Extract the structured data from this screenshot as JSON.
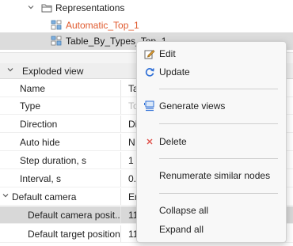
{
  "tree": {
    "representations_label": "Representations",
    "auto_label": "Automatic_Top_1",
    "table_label": "Table_By_Types_Top_1"
  },
  "properties": {
    "section_title": "Exploded view",
    "rows": [
      {
        "name": "Name",
        "value": "Ta"
      },
      {
        "name": "Type",
        "value": "To"
      },
      {
        "name": "Direction",
        "value": "Di"
      },
      {
        "name": "Auto hide",
        "value": "N"
      },
      {
        "name": "Step duration, s",
        "value": "1"
      },
      {
        "name": "Interval, s",
        "value": "0."
      },
      {
        "name": "Default camera",
        "value": "Er"
      },
      {
        "name": "Default camera posit..",
        "value": "11"
      },
      {
        "name": "Default target position",
        "value": "11"
      }
    ]
  },
  "context_menu": {
    "items": {
      "edit": "Edit",
      "update": "Update",
      "generate_views": "Generate views",
      "delete": "Delete",
      "renumerate": "Renumerate similar nodes",
      "collapse_all": "Collapse all",
      "expand_all": "Expand all"
    }
  },
  "colors": {
    "accent_orange": "#e05a2e",
    "update_blue": "#2f6fd6",
    "delete_red": "#e0504a"
  }
}
